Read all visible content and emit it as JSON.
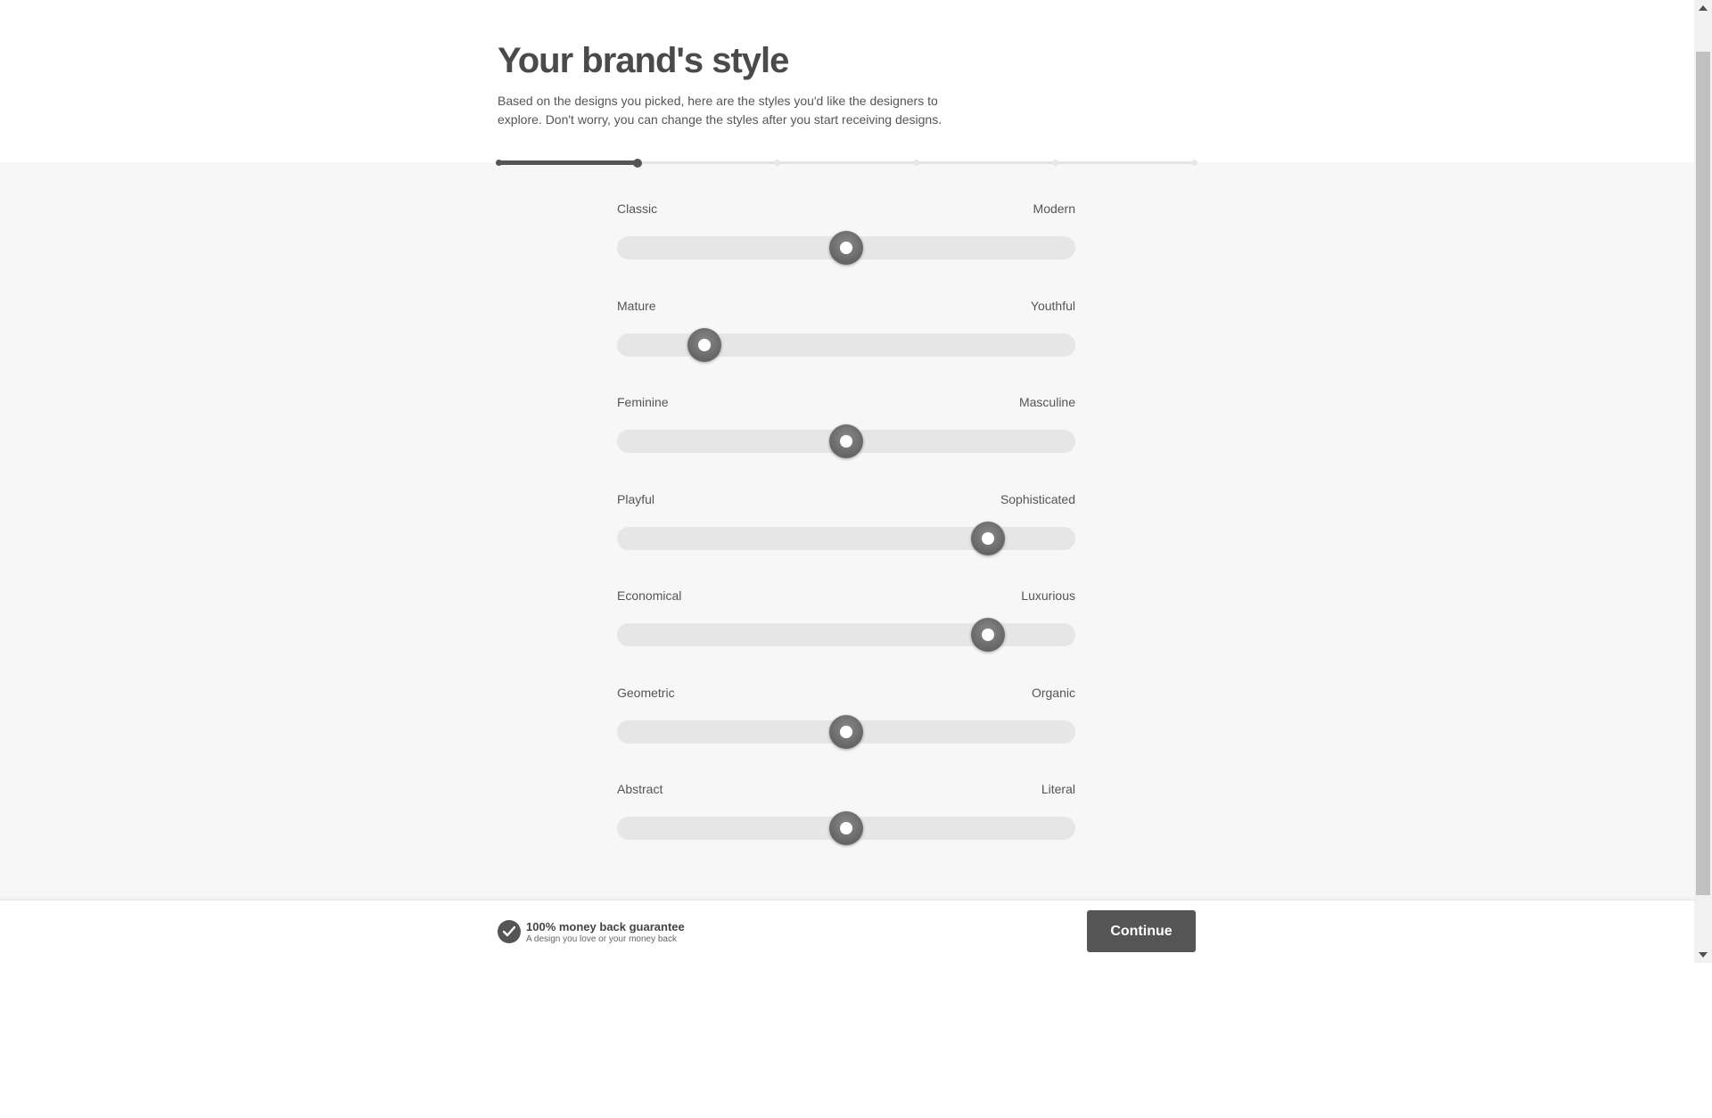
{
  "header": {
    "title": "Your brand's style",
    "subtitle": "Based on the designs you picked, here are the styles you'd like the designers to explore. Don't worry, you can change the styles after you start receiving designs."
  },
  "progress": {
    "total_steps": 6,
    "current_step": 2
  },
  "sliders": [
    {
      "left": "Classic",
      "right": "Modern",
      "value": 0.5
    },
    {
      "left": "Mature",
      "right": "Youthful",
      "value": 0.19
    },
    {
      "left": "Feminine",
      "right": "Masculine",
      "value": 0.5
    },
    {
      "left": "Playful",
      "right": "Sophisticated",
      "value": 0.81
    },
    {
      "left": "Economical",
      "right": "Luxurious",
      "value": 0.81
    },
    {
      "left": "Geometric",
      "right": "Organic",
      "value": 0.5
    },
    {
      "left": "Abstract",
      "right": "Literal",
      "value": 0.5
    }
  ],
  "footer": {
    "guarantee_title": "100% money back guarantee",
    "guarantee_sub": "A design you love or your money back",
    "continue_label": "Continue"
  },
  "colors": {
    "accent": "#555555",
    "background": "#f7f7f7",
    "track": "#e6e6e6"
  },
  "icons": {
    "guarantee": "check-circle-icon"
  }
}
